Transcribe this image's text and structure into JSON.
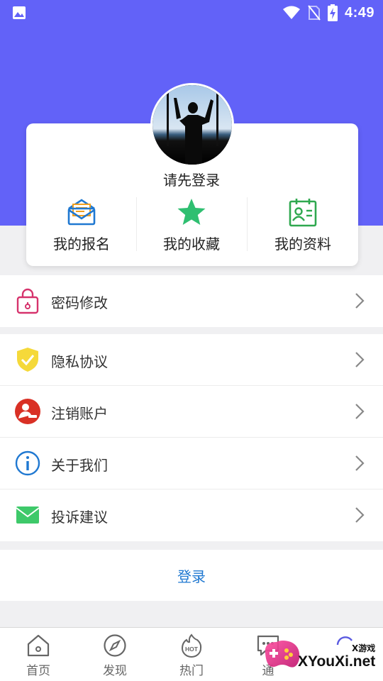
{
  "status_bar": {
    "time": "4:49"
  },
  "profile": {
    "login_hint": "请先登录"
  },
  "shortcuts": [
    {
      "label": "我的报名",
      "icon": "envelope-icon",
      "color": "#1f78d1"
    },
    {
      "label": "我的收藏",
      "icon": "star-icon",
      "color": "#2fbf71"
    },
    {
      "label": "我的资料",
      "icon": "id-card-icon",
      "color": "#2fa84f"
    }
  ],
  "menu": {
    "group1": [
      {
        "label": "密码修改",
        "icon": "lock-icon",
        "color": "#d6336c"
      }
    ],
    "group2": [
      {
        "label": "隐私协议",
        "icon": "shield-check-icon",
        "color": "#f5d93a"
      },
      {
        "label": "注销账户",
        "icon": "user-remove-icon",
        "color": "#d93025"
      },
      {
        "label": "关于我们",
        "icon": "info-icon",
        "color": "#1f78d1"
      },
      {
        "label": "投诉建议",
        "icon": "mail-icon",
        "color": "#3ec96a"
      }
    ]
  },
  "login_button": "登录",
  "tabs": [
    {
      "label": "首页",
      "icon": "home-icon"
    },
    {
      "label": "发现",
      "icon": "compass-icon"
    },
    {
      "label": "热门",
      "icon": "hot-icon"
    },
    {
      "label": "通",
      "icon": "message-icon"
    },
    {
      "label": "",
      "icon": "user-icon"
    }
  ],
  "watermark": {
    "small": "X游戏",
    "big": "XYouXi.net"
  },
  "colors": {
    "hero": "#6262f8",
    "accent": "#1f78d1"
  }
}
